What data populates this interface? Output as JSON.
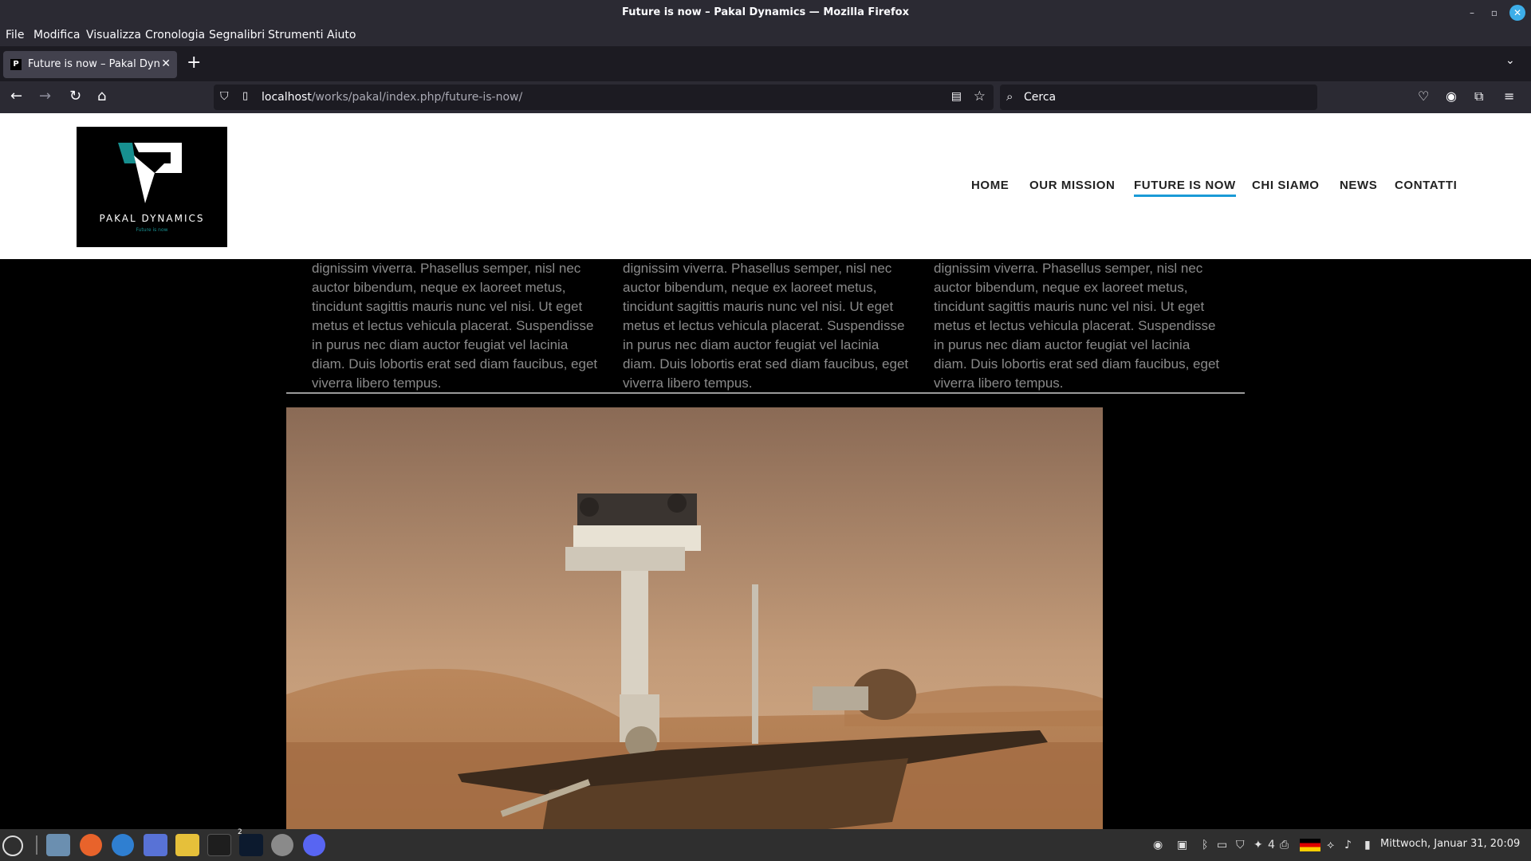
{
  "window": {
    "title": "Future is now – Pakal Dynamics — Mozilla Firefox"
  },
  "menu": [
    "File",
    "Modifica",
    "Visualizza",
    "Cronologia",
    "Segnalibri",
    "Strumenti",
    "Aiuto"
  ],
  "tab": {
    "title": "Future is now – Pakal Dynamics",
    "favicon_letter": "P"
  },
  "urlbar": {
    "host": "localhost",
    "path": "/works/pakal/index.php/future-is-now/"
  },
  "search": {
    "placeholder": "Cerca"
  },
  "site": {
    "brand": "PAKAL DYNAMICS",
    "tagline": "Future is now",
    "nav": [
      "HOME",
      "OUR MISSION",
      "FUTURE IS NOW",
      "CHI SIAMO",
      "NEWS",
      "CONTATTI"
    ],
    "active_nav": "FUTURE IS NOW",
    "columns": [
      [
        "dignissim viverra. Phasellus semper, nisl nec",
        "auctor bibendum, neque ex laoreet metus,",
        "tincidunt sagittis mauris nunc vel nisi. Ut eget",
        "metus et lectus vehicula placerat. Suspendisse",
        "in purus nec diam auctor feugiat vel lacinia",
        "diam. Duis lobortis erat sed diam faucibus, eget",
        "viverra libero tempus."
      ],
      [
        "dignissim viverra. Phasellus semper, nisl nec",
        "auctor bibendum, neque ex laoreet metus,",
        "tincidunt sagittis mauris nunc vel nisi. Ut eget",
        "metus et lectus vehicula placerat. Suspendisse",
        "in purus nec diam auctor feugiat vel lacinia",
        "diam. Duis lobortis erat sed diam faucibus, eget",
        "viverra libero tempus."
      ],
      [
        "dignissim viverra. Phasellus semper, nisl nec",
        "auctor bibendum, neque ex laoreet metus,",
        "tincidunt sagittis mauris nunc vel nisi. Ut eget",
        "metus et lectus vehicula placerat. Suspendisse",
        "in purus nec diam auctor feugiat vel lacinia",
        "diam. Duis lobortis erat sed diam faucibus, eget",
        "viverra libero tempus."
      ]
    ]
  },
  "taskbar": {
    "workspace_badge": "2",
    "notification_count": "4",
    "clock": "Mittwoch, Januar 31, 20:09"
  },
  "colors": {
    "accent": "#1a9ad6",
    "logo_tagline": "#178f8f",
    "chrome": "#2b2a33"
  }
}
